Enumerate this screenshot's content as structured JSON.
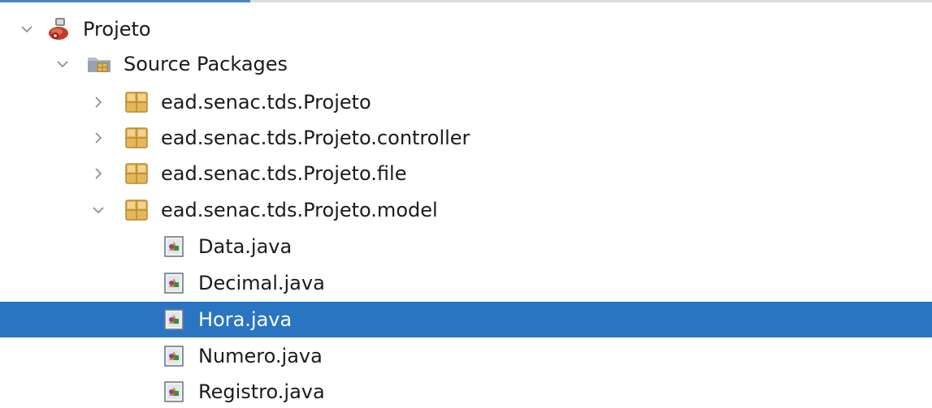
{
  "tree": {
    "project": {
      "label": "Projeto",
      "expanded": true,
      "icon": "project-icon"
    },
    "source_packages": {
      "label": "Source Packages",
      "expanded": true,
      "icon": "source-packages-folder-icon"
    },
    "packages": [
      {
        "label": "ead.senac.tds.Projeto",
        "expanded": false,
        "icon": "package-icon"
      },
      {
        "label": "ead.senac.tds.Projeto.controller",
        "expanded": false,
        "icon": "package-icon"
      },
      {
        "label": "ead.senac.tds.Projeto.file",
        "expanded": false,
        "icon": "package-icon"
      },
      {
        "label": "ead.senac.tds.Projeto.model",
        "expanded": true,
        "icon": "package-icon"
      }
    ],
    "files": [
      {
        "label": "Data.java",
        "icon": "java-class-icon",
        "selected": false
      },
      {
        "label": "Decimal.java",
        "icon": "java-class-icon",
        "selected": false
      },
      {
        "label": "Hora.java",
        "icon": "java-class-icon",
        "selected": true
      },
      {
        "label": "Numero.java",
        "icon": "java-class-icon",
        "selected": false
      },
      {
        "label": "Registro.java",
        "icon": "java-class-icon",
        "selected": false
      }
    ]
  },
  "colors": {
    "selection": "#2a75c2",
    "text": "#1b1b1b",
    "selected_text": "#ffffff",
    "package_icon": "#e4b85a",
    "chevron": "#8a8a8a"
  }
}
